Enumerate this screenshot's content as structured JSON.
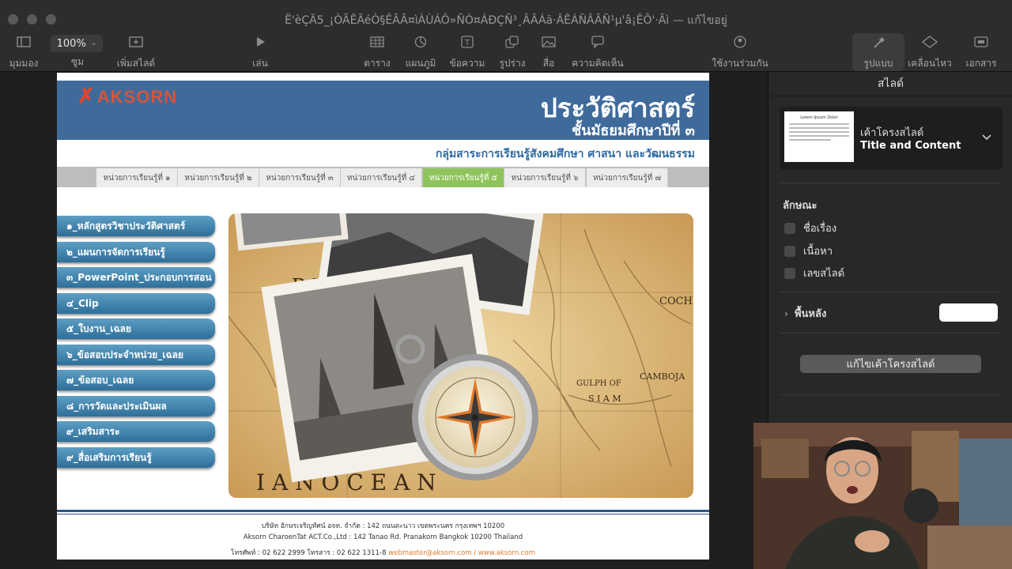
{
  "window": {
    "title": "Ë'èÇÄ5_¡ÒÃÊÃéÒ§ÊÃÃ¤ìÀÙÁÔ»ÑÒ¤ÁÐÇÑ³¸ÃÃÁä·ÂÊÁÑÂÃÑ¹µ'â¡ÊÔ'·Ãì — แก้ไขอยู่"
  },
  "toolbar": {
    "view_label": "มุมมอง",
    "zoom_value": "100%",
    "zoom_label": "ซูม",
    "add_slide_label": "เพิ่มสไลด์",
    "play_label": "เล่น",
    "table_label": "ตาราง",
    "chart_label": "แผนภูมิ",
    "text_label": "ข้อความ",
    "shape_label": "รูปร่าง",
    "media_label": "สื่อ",
    "comment_label": "ความคิดเห็น",
    "collaborate_label": "ใช้งานร่วมกัน",
    "format_label": "รูปแบบ",
    "animate_label": "เคลื่อนไหว",
    "document_label": "เอกสาร"
  },
  "slide": {
    "logo_text": "AKSORN",
    "title": "ประวัติศาสตร์",
    "subtitle": "ชั้นมัธยมศึกษาปีที่  ๓",
    "group": "กลุ่มสาระการเรียนรู้สังคมศึกษา ศาสนา และวัฒนธรรม",
    "tabs": [
      "หน่วยการเรียนรู้ที่ ๑",
      "หน่วยการเรียนรู้ที่ ๒",
      "หน่วยการเรียนรู้ที่ ๓",
      "หน่วยการเรียนรู้ที่ ๔",
      "หน่วยการเรียนรู้ที่ ๕",
      "หน่วยการเรียนรู้ที่ ๖",
      "หน่วยการเรียนรู้ที่ ๗"
    ],
    "active_tab": 4,
    "menu": [
      "๑_หลักสูตรวิชาประวัติศาสตร์",
      "๒_แผนการจัดการเรียนรู้",
      "๓_PowerPoint_ประกอบการสอน",
      "๔_Clip",
      "๕_ใบงาน_เฉลย",
      "๖_ข้อสอบประจำหน่วย_เฉลย",
      "๗_ข้อสอบ_เฉลย",
      "๘_การวัดและประเมินผล",
      "๙_เสริมสาระ",
      "๙_สื่อเสริมการเรียนรู้"
    ],
    "map_labels": {
      "bay": "GULPH OF",
      "siam": "S I A M",
      "ocean": "I A N   O C E A N",
      "cochin": "COCHI",
      "be": "B E",
      "camboja": "CAMBOJA"
    },
    "footer": {
      "line1": "บริษัท อักษรเจริญทัศน์ อจท. จำกัด : 142 ถนนตะนาว เขตพระนคร กรุงเทพฯ 10200",
      "line2": "Aksorn CharoenTat ACT.Co.,Ltd : 142 Tanao Rd. Pranakorn Bangkok 10200 Thailand",
      "line3_prefix": "โทรศัพท์ : 02 622 2999  โทรสาร : 02 622 1311-8",
      "line3_links": "webmaster@aksorn.com / www.aksorn.com"
    }
  },
  "inspector": {
    "header": "สไลด์",
    "layout_name": "เค้าโครงสไลด์",
    "layout_value": "Title and Content",
    "appearance_label": "ลักษณะ",
    "checkboxes": [
      "ชื่อเรื่อง",
      "เนื้อหา",
      "เลขสไลด์"
    ],
    "background_label": "พื้นหลัง",
    "edit_layout_button": "แก้ไขเค้าโครงสไลด์",
    "thumb_title": "Lorem Ipsum Dolor"
  },
  "colors": {
    "banner": "#3f6b9c",
    "tab_active": "#8fc45c",
    "menu_button": "#2e6f99"
  }
}
